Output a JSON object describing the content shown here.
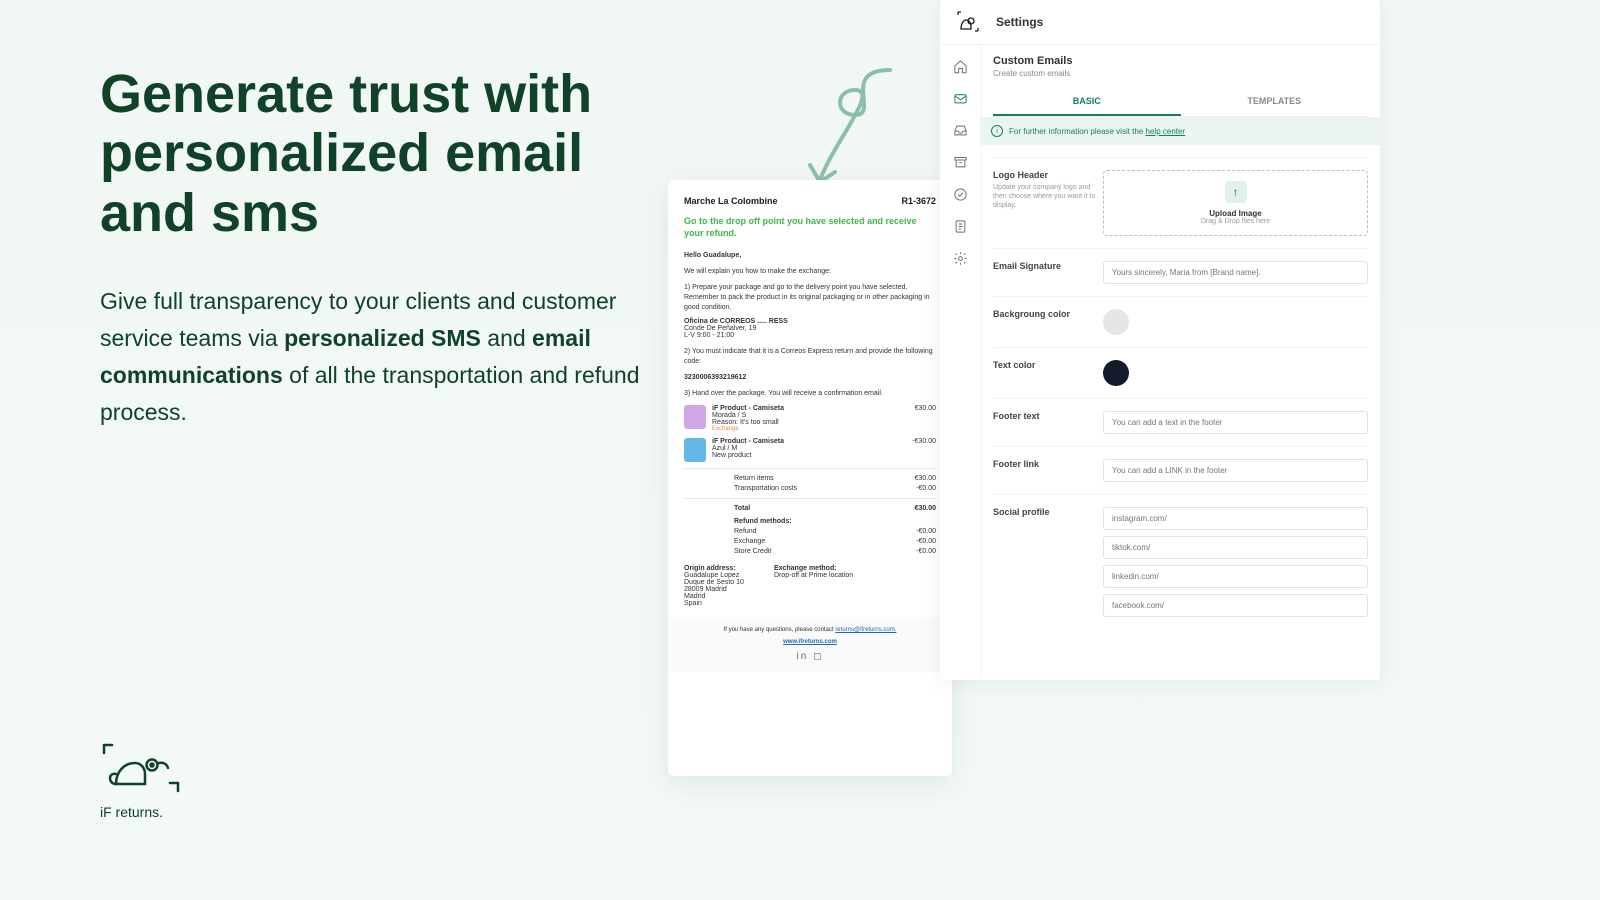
{
  "marketing": {
    "headline": "Generate trust with personalized email and sms",
    "body_1": "Give full transparency to your clients and customer service teams via ",
    "body_strong_1": "personalized SMS",
    "body_2": " and ",
    "body_strong_2": "email communications",
    "body_3": " of all the transportation and refund process."
  },
  "brand": {
    "name": "iF returns."
  },
  "email": {
    "merchant": "Marche La Colombine",
    "ref": "R1-3672",
    "headline": "Go to the drop off point you have selected and receive your refund.",
    "greeting": "Hello Guadalupe,",
    "intro": "We will explain you how to make the exchange:",
    "step1": "1) Prepare your package and go to the delivery point you have selected. Remember to pack the product in its original packaging or in other packaging in good condition.",
    "office_name": "Oficina de CORREOS ..... RESS",
    "office_addr": "Conde De Peñalver, 19",
    "office_hours": "L-V 9:00 - 21:00",
    "step2": "2) You must indicate that it is a Correos Express return and provide the following code:",
    "code": "3230006393219612",
    "step3": "3) Hand over the package. You will receive a confirmation email.",
    "products": [
      {
        "name": "iF Product - Camiseta",
        "variant": "Morada / S",
        "reason": "Reason: It's too small",
        "tag": "Exchange",
        "price": "€30.00"
      },
      {
        "name": "iF Product - Camiseta",
        "variant": "Azul / M",
        "reason": "New product",
        "tag": "",
        "price": "-€30.00"
      }
    ],
    "summary": {
      "return_items_label": "Return items",
      "return_items_value": "€30.00",
      "transport_label": "Transportation costs",
      "transport_value": "-€0.00",
      "total_label": "Total",
      "total_value": "€30.00",
      "methods_label": "Refund methods:",
      "refund_label": "Refund",
      "refund_value": "-€0.00",
      "exchange_label": "Exchange",
      "exchange_value": "-€0.00",
      "store_credit_label": "Store Credit",
      "store_credit_value": "-€0.00"
    },
    "origin": {
      "heading": "Origin address:",
      "name": "Guadalupe Lopez",
      "line1": "Duque de Sesto 10",
      "line2": "28009 Madrid",
      "city": "Madrid",
      "country": "Spain"
    },
    "exchange": {
      "heading": "Exchange method:",
      "text": "Drop-off at Prime location"
    },
    "footer": {
      "text": "If you have any questions, please contact ",
      "email": "returns@ifreturns.com.",
      "site": "www.ifreturns.com"
    }
  },
  "settings": {
    "title": "Settings",
    "heading": "Custom Emails",
    "sub": "Create custom emails",
    "tabs": {
      "basic": "BASIC",
      "templates": "TEMPLATES"
    },
    "info_text": "For further information please visit the ",
    "info_link": "help center",
    "fields": {
      "logo_label": "Logo Header",
      "logo_desc": "Update your company logo and then choose where you want it to display.",
      "upload_title": "Upload Image",
      "upload_sub": "Drag & Drop files here",
      "sig_label": "Email Signature",
      "sig_placeholder": "Yours sincerely, Maria from [Brand name].",
      "bg_label": "Backgroung color",
      "text_label": "Text color",
      "footer_text_label": "Footer text",
      "footer_text_placeholder": "You can add a text in the footer",
      "footer_link_label": "Footer link",
      "footer_link_placeholder": "You can add a LINK in the footer",
      "social_label": "Social profile",
      "social": [
        "instagram.com/",
        "tiktok.com/",
        "linkedin.com/",
        "facebook.com/"
      ]
    }
  }
}
